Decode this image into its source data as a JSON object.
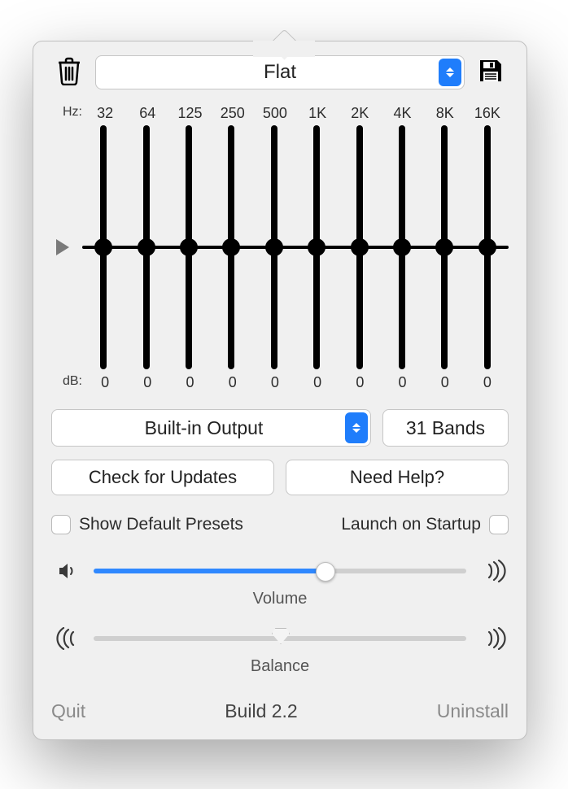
{
  "preset": {
    "selected": "Flat"
  },
  "eq": {
    "hz_label": "Hz:",
    "db_label": "dB:",
    "freqs": [
      "32",
      "64",
      "125",
      "250",
      "500",
      "1K",
      "2K",
      "4K",
      "8K",
      "16K"
    ],
    "gains": [
      "0",
      "0",
      "0",
      "0",
      "0",
      "0",
      "0",
      "0",
      "0",
      "0"
    ]
  },
  "output": {
    "selected": "Built-in Output"
  },
  "bands_button": "31 Bands",
  "buttons": {
    "check_updates": "Check for Updates",
    "need_help": "Need Help?"
  },
  "checkboxes": {
    "show_default_presets": {
      "label": "Show Default Presets",
      "checked": false
    },
    "launch_on_startup": {
      "label": "Launch on Startup",
      "checked": false
    }
  },
  "sliders": {
    "volume": {
      "label": "Volume",
      "percent": 62
    },
    "balance": {
      "label": "Balance",
      "percent": 50
    }
  },
  "footer": {
    "quit": "Quit",
    "build": "Build 2.2",
    "uninstall": "Uninstall"
  }
}
